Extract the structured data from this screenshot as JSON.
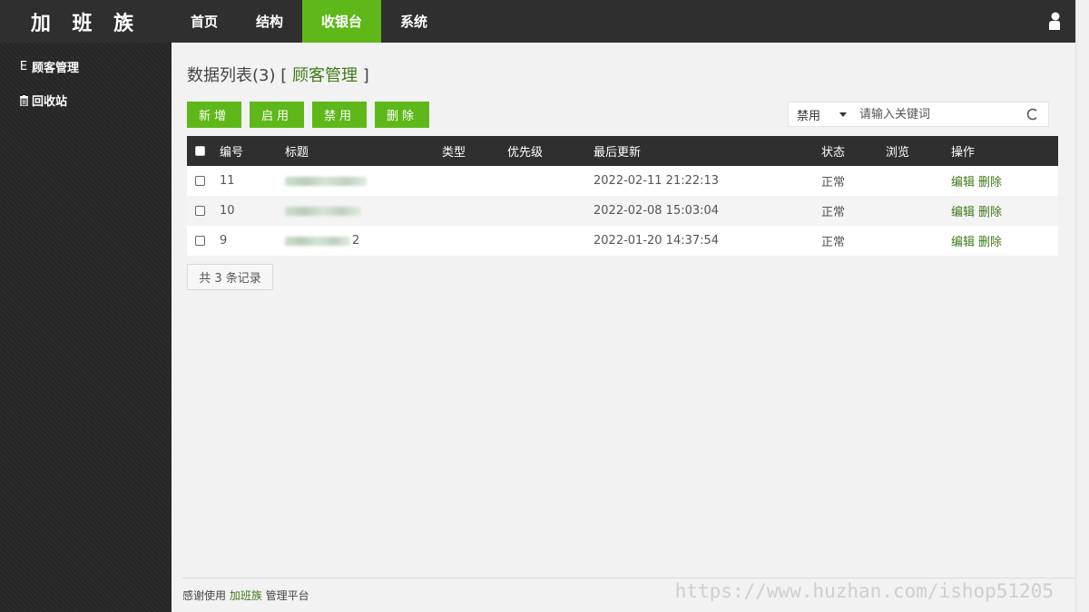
{
  "header": {
    "logo": "加 班 族",
    "nav": [
      {
        "label": "首页",
        "active": false
      },
      {
        "label": "结构",
        "active": false
      },
      {
        "label": "收银台",
        "active": true
      },
      {
        "label": "系统",
        "active": false
      }
    ],
    "user_icon": "user-icon"
  },
  "sidebar": {
    "items": [
      {
        "label": "顾客管理",
        "icon": "E"
      },
      {
        "label": "回收站",
        "icon": "trash-icon"
      }
    ]
  },
  "main": {
    "title_prefix": "数据列表(3) [",
    "title_accent": " 顾客管理 ",
    "title_suffix": "]",
    "buttons": [
      "新增",
      "启用",
      "禁用",
      "删除"
    ],
    "search": {
      "select_value": "禁用",
      "placeholder": "请输入关键词"
    },
    "table": {
      "headers": [
        "编号",
        "标题",
        "类型",
        "优先级",
        "最后更新",
        "状态",
        "浏览",
        "操作"
      ],
      "rows": [
        {
          "id": "11",
          "title": "",
          "type": "",
          "priority": "",
          "updated": "2022-02-11 21:22:13",
          "status": "正常",
          "views": "",
          "edit": "编辑",
          "delete": "删除"
        },
        {
          "id": "10",
          "title": "",
          "type": "",
          "priority": "",
          "updated": "2022-02-08 15:03:04",
          "status": "正常",
          "views": "",
          "edit": "编辑",
          "delete": "删除"
        },
        {
          "id": "9",
          "title": "2",
          "type": "",
          "priority": "",
          "updated": "2022-01-20 14:37:54",
          "status": "正常",
          "views": "",
          "edit": "编辑",
          "delete": "删除"
        }
      ]
    },
    "record_count": "共 3 条记录"
  },
  "footer": {
    "text_prefix": "感谢使用 ",
    "text_accent": "加班族",
    "text_suffix": " 管理平台",
    "watermark": "https://www.huzhan.com/ishop51205"
  },
  "colors": {
    "accent": "#5fb81a",
    "dark": "#2f2f2f",
    "link": "#3f7a1a"
  }
}
